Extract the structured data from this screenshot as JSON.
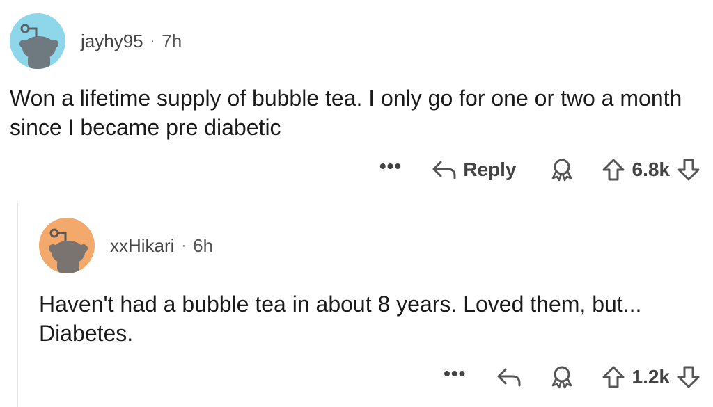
{
  "comments": [
    {
      "username": "jayhy95",
      "separator": "·",
      "time": "7h",
      "avatar_color": "#8ed6ea",
      "text": "Won a lifetime supply of bubble tea. I only go for one or two a month since I became pre diabetic",
      "more_label": "•••",
      "reply_label": "Reply",
      "score": "6.8k"
    },
    {
      "username": "xxHikari",
      "separator": "·",
      "time": "6h",
      "avatar_color": "#f3a96b",
      "text": "Haven't had a bubble tea in about 8 years. Loved them, but... Diabetes.",
      "more_label": "•••",
      "score": "1.2k"
    }
  ],
  "icons": {
    "reply": "reply-arrow-icon",
    "award": "award-icon",
    "upvote": "upvote-arrow-icon",
    "downvote": "downvote-arrow-icon"
  }
}
